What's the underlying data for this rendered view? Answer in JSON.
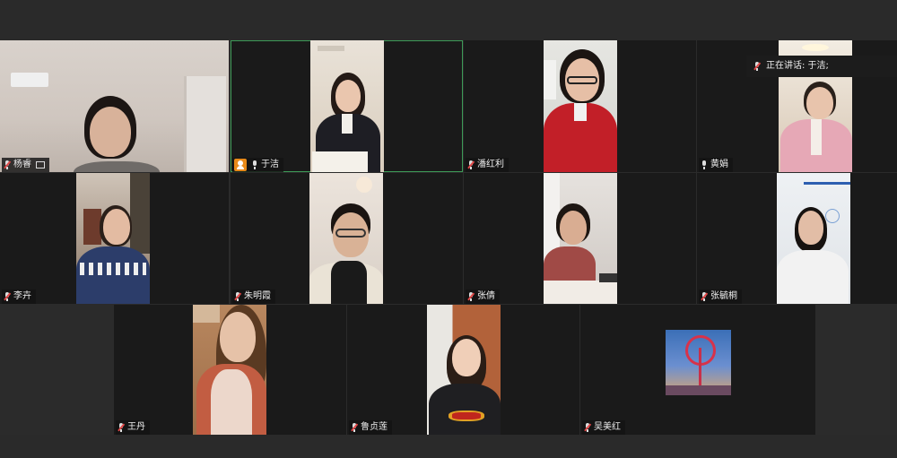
{
  "speaking_indicator": {
    "text": "正在讲话: 于洁;"
  },
  "participants": [
    {
      "name": "杨睿"
    },
    {
      "name": "于洁"
    },
    {
      "name": "潘红利"
    },
    {
      "name": "黄娟"
    },
    {
      "name": "李卉"
    },
    {
      "name": "朱明霞"
    },
    {
      "name": "张倩"
    },
    {
      "name": "张毓桐"
    },
    {
      "name": "王丹"
    },
    {
      "name": "鲁贞莲"
    },
    {
      "name": "吴美红"
    }
  ],
  "colors": {
    "active_border": "#3d9b57",
    "host_badge": "#e88a1a",
    "muted_slash": "#e04848"
  }
}
